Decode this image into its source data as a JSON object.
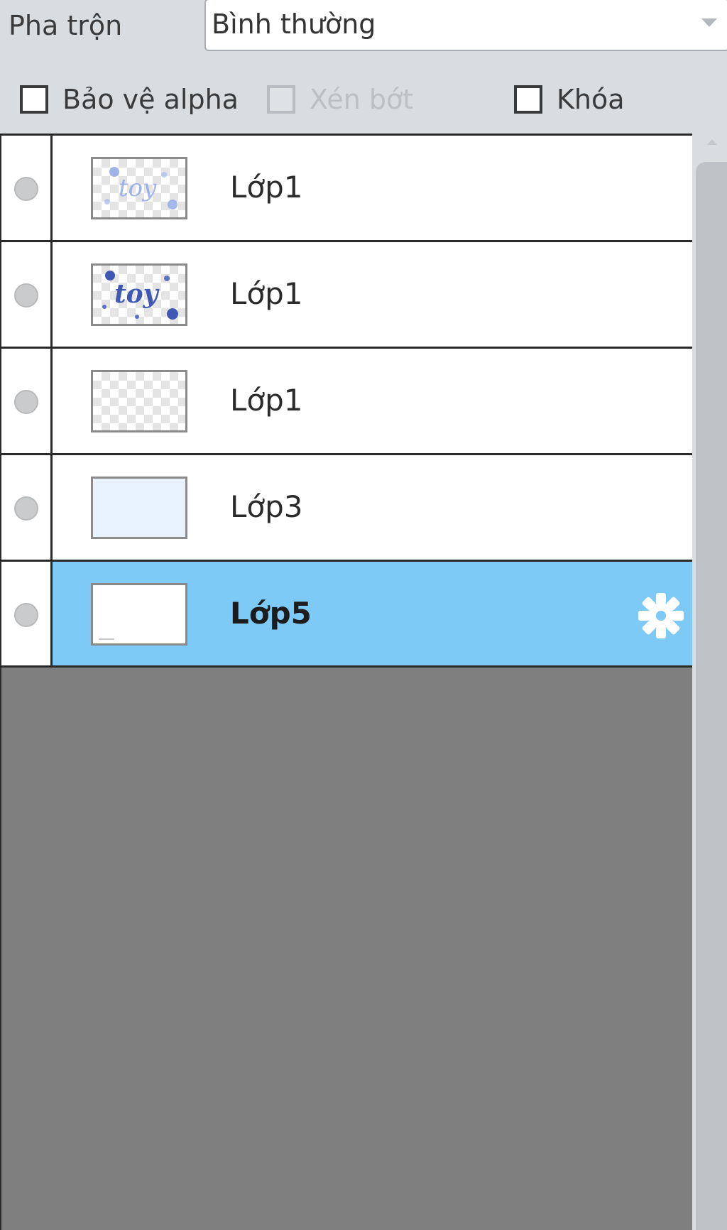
{
  "blend": {
    "label": "Pha trộn",
    "value": "Bình thường"
  },
  "options": {
    "protect_alpha": {
      "label": "Bảo vệ alpha",
      "checked": false,
      "enabled": true
    },
    "clipping": {
      "label": "Xén bớt",
      "checked": false,
      "enabled": false
    },
    "lock": {
      "label": "Khóa",
      "checked": false,
      "enabled": true
    }
  },
  "layers": [
    {
      "name": "Lớp1",
      "thumbnail": "toy-light",
      "selected": false
    },
    {
      "name": "Lớp1",
      "thumbnail": "toy-dark",
      "selected": false
    },
    {
      "name": "Lớp1",
      "thumbnail": "transparent",
      "selected": false
    },
    {
      "name": "Lớp3",
      "thumbnail": "light-blue-fill",
      "selected": false
    },
    {
      "name": "Lớp5",
      "thumbnail": "white",
      "selected": true,
      "icon": "gear-icon"
    }
  ],
  "colors": {
    "selected_row": "#7ccaf5",
    "empty_area": "#7f7f7f",
    "panel_bg": "#d9dde0"
  }
}
